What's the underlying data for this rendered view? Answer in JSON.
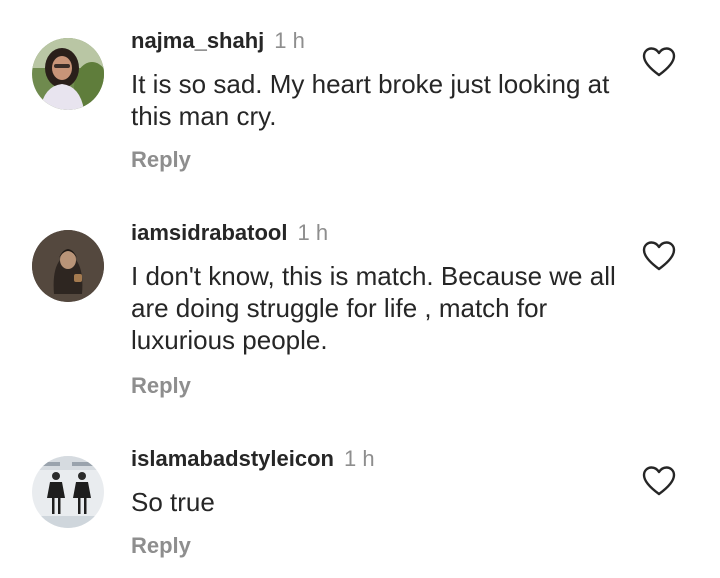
{
  "comments": [
    {
      "username": "najma_shahj",
      "time": "1 h",
      "text": "It is so sad. My heart broke just looking at this man cry.",
      "reply": "Reply",
      "avatar": "profile-photo-woman-glasses",
      "like_icon": "heart-outline-icon"
    },
    {
      "username": "iamsidrabatool",
      "time": "1 h",
      "text": "I don't know, this is match. Because we all are doing struggle for life , match for luxurious people.",
      "reply": "Reply",
      "avatar": "profile-photo-hooded-figure",
      "like_icon": "heart-outline-icon"
    },
    {
      "username": "islamabadstyleicon",
      "time": "1 h",
      "text": "So true",
      "reply": "Reply",
      "avatar": "profile-photo-fashion-models",
      "like_icon": "heart-outline-icon"
    }
  ],
  "colors": {
    "text_primary": "#262626",
    "text_secondary": "#8e8e8e",
    "background": "#ffffff"
  }
}
